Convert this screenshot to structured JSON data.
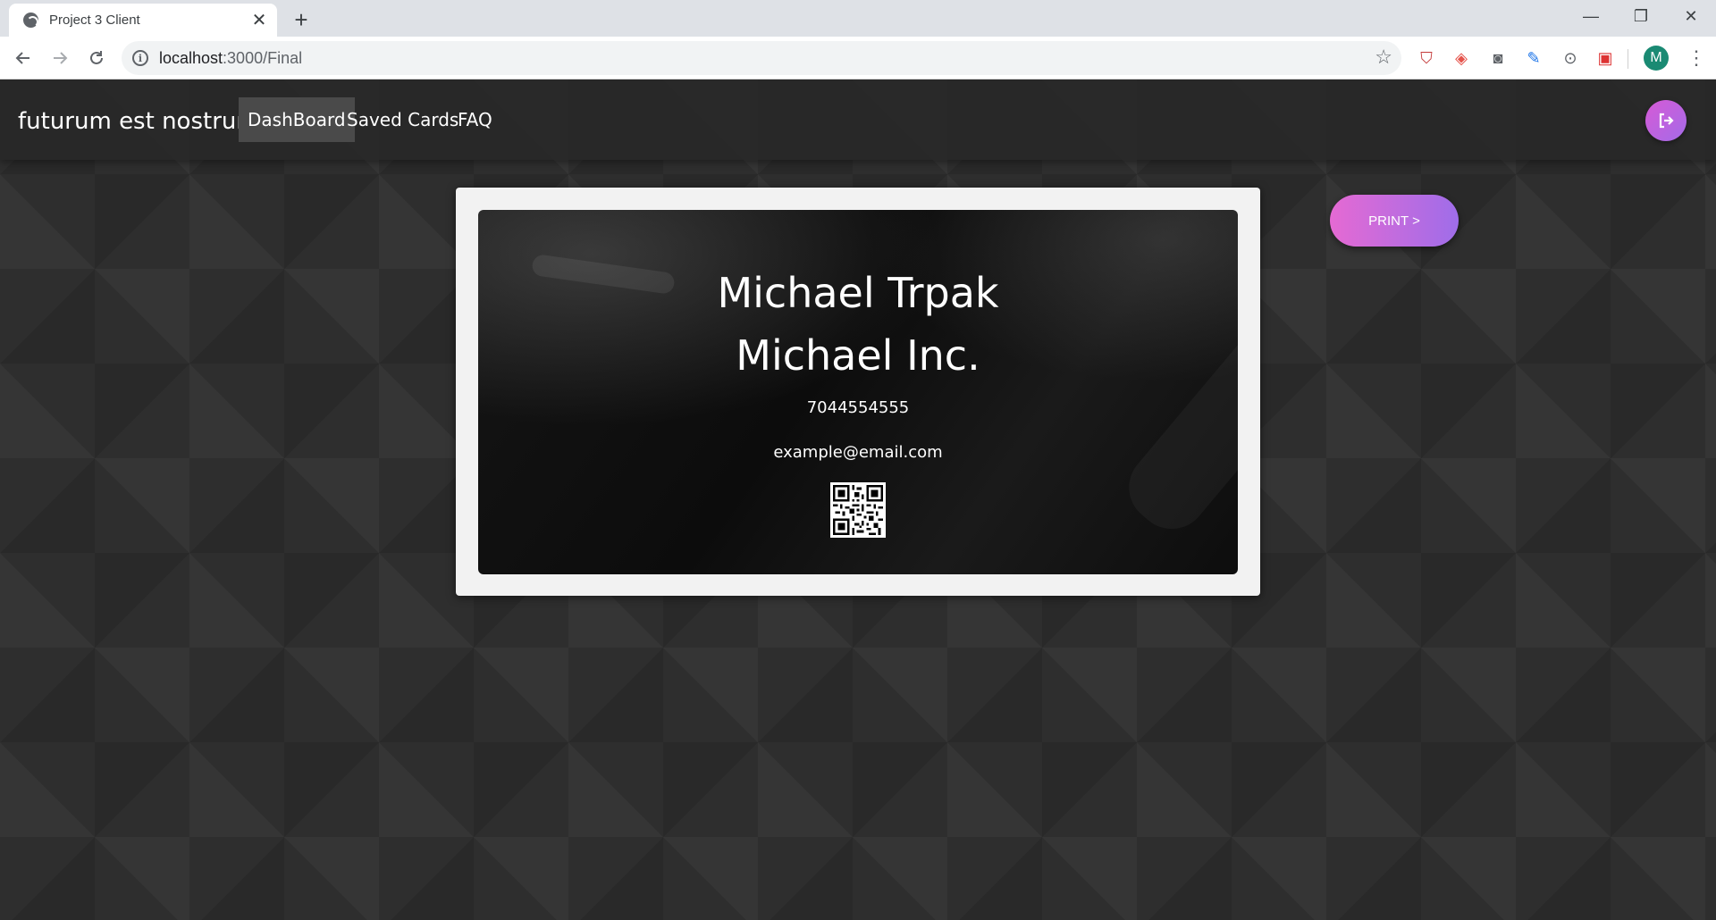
{
  "browser": {
    "tab_title": "Project 3 Client",
    "tab_close": "✕",
    "new_tab": "+",
    "url_host": "localhost",
    "url_path": ":3000/Final",
    "profile_initial": "M"
  },
  "app": {
    "brand": "futurum est nostrum",
    "nav": [
      "DashBoard",
      "Saved Cards",
      "FAQ"
    ],
    "active_nav": "DashBoard",
    "print_label": "PRINT >"
  },
  "card": {
    "name": "Michael Trpak",
    "company": "Michael Inc.",
    "phone": "7044554555",
    "email": "example@email.com"
  },
  "icons": {
    "back": "arrow-left-icon",
    "forward": "arrow-right-icon",
    "reload": "reload-icon",
    "info": "info-icon",
    "bookmark": "star-icon",
    "logout": "logout-icon",
    "qr": "qr-code-icon"
  },
  "colors": {
    "accent_start": "#e56ad3",
    "accent_end": "#9f6de9",
    "navbar": "#282828",
    "active_nav_bg": "#4a4a4a"
  }
}
